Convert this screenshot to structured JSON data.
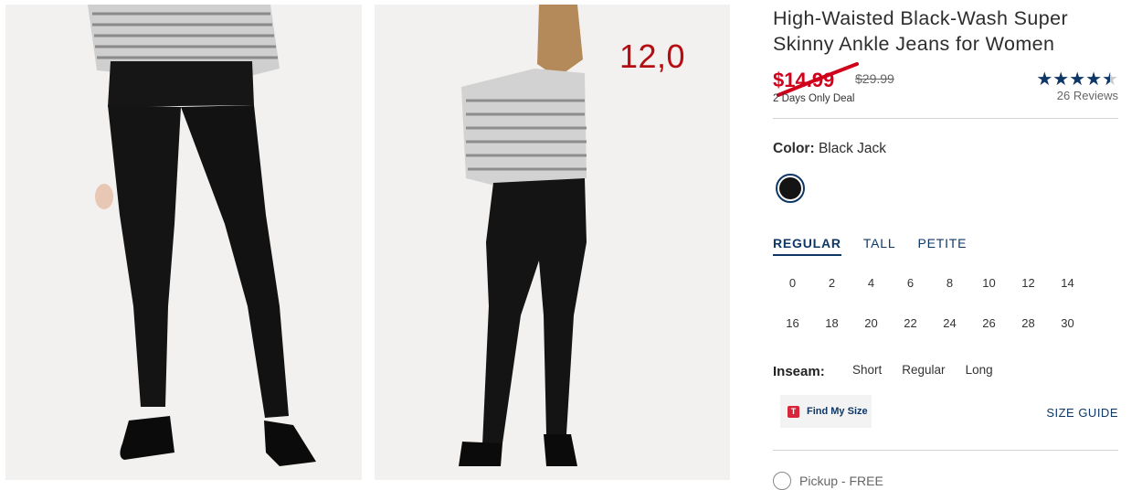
{
  "gallery": {
    "overlay_number": "12,0",
    "images": [
      {
        "alt": "front view"
      },
      {
        "alt": "back view"
      }
    ]
  },
  "product": {
    "title": "High-Waisted Black-Wash Super Skinny Ankle Jeans for Women",
    "sale_price": "$14.99",
    "original_price": "$29.99",
    "deal_text": "2 Days Only Deal",
    "rating_stars": "★★★★★",
    "rating_value": 4.5,
    "reviews_text": "26 Reviews"
  },
  "color": {
    "label": "Color:",
    "value": "Black Jack",
    "swatch_hex": "#141414"
  },
  "fit_tabs": [
    {
      "label": "REGULAR",
      "active": true
    },
    {
      "label": "TALL",
      "active": false
    },
    {
      "label": "PETITE",
      "active": false
    }
  ],
  "sizes": [
    "0",
    "2",
    "4",
    "6",
    "8",
    "10",
    "12",
    "14",
    "16",
    "18",
    "20",
    "22",
    "24",
    "26",
    "28",
    "30"
  ],
  "inseam": {
    "label": "Inseam:",
    "options": [
      "Short",
      "Regular",
      "Long"
    ]
  },
  "find_my_size": {
    "badge": "T",
    "label": "Find My Size"
  },
  "size_guide_label": "SIZE GUIDE",
  "fulfillment": {
    "pickup_label": "Pickup - FREE"
  },
  "colors": {
    "accent": "#0e3766",
    "sale": "#d0021b",
    "overlay": "#b50d12"
  }
}
